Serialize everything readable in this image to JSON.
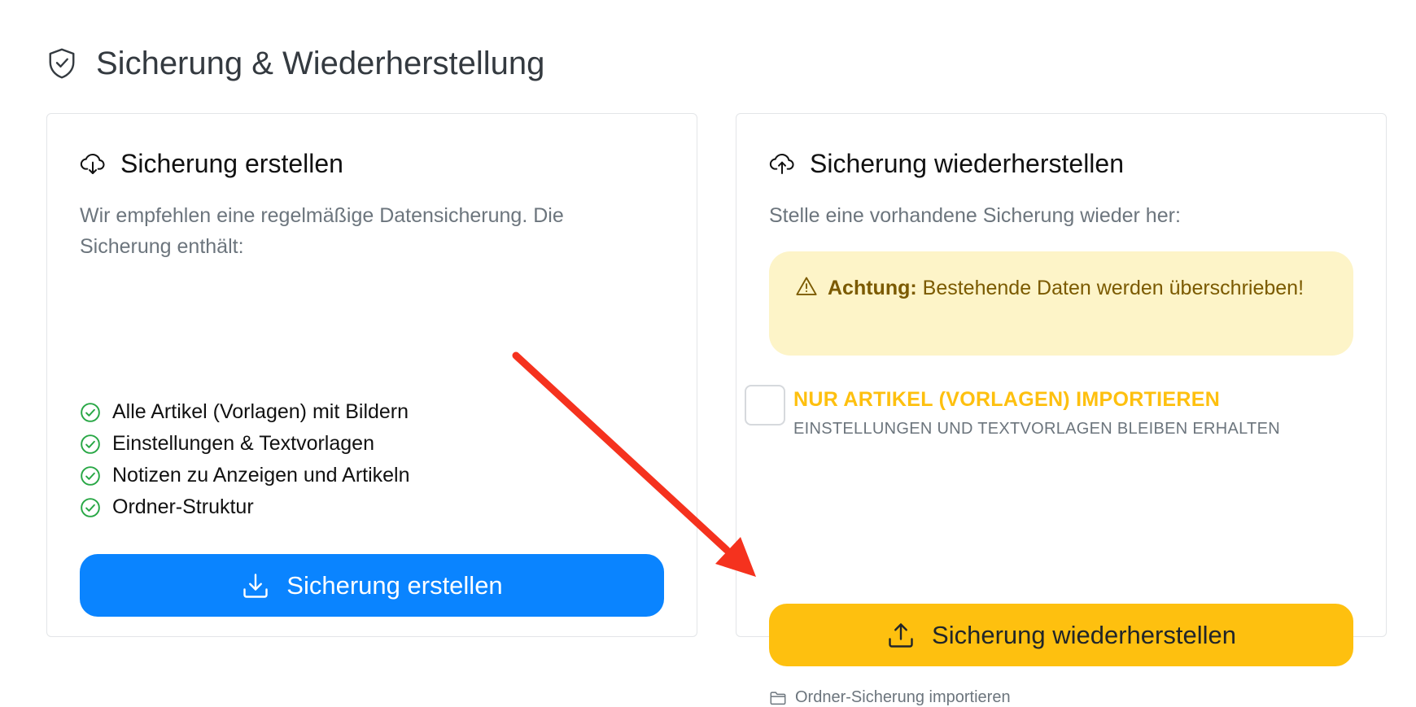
{
  "page": {
    "title": "Sicherung & Wiederherstellung",
    "icon": "shield-check-icon"
  },
  "create": {
    "title": "Sicherung erstellen",
    "icon": "cloud-download-icon",
    "description": "Wir empfehlen eine regelmäßige Datensicherung. Die Sicherung enthält:",
    "features": [
      "Alle Artikel (Vorlagen) mit Bildern",
      "Einstellungen & Textvorlagen",
      "Notizen zu Anzeigen und Artikeln",
      "Ordner-Struktur"
    ],
    "feature_icon": "check-circle-icon",
    "button_label": "Sicherung erstellen",
    "button_icon": "download-icon",
    "button_color": "#0a84ff"
  },
  "restore": {
    "title": "Sicherung wiederherstellen",
    "icon": "cloud-upload-icon",
    "description": "Stelle eine vorhandene Sicherung wieder her:",
    "alert": {
      "icon": "warning-triangle-icon",
      "strong": "Achtung:",
      "text": " Bestehende Daten werden überschrieben!"
    },
    "checkbox": {
      "label": "NUR ARTIKEL (VORLAGEN) IMPORTIEREN",
      "hint": "EINSTELLUNGEN UND TEXTVORLAGEN BLEIBEN ERHALTEN",
      "checked": false
    },
    "button_label": "Sicherung wiederherstellen",
    "button_icon": "upload-icon",
    "button_color": "#fec00f",
    "folder_link": "Ordner-Sicherung importieren",
    "folder_icon": "folder-icon"
  },
  "annotation": {
    "arrow_color": "#f5321e",
    "icon": "red-arrow-annotation"
  }
}
